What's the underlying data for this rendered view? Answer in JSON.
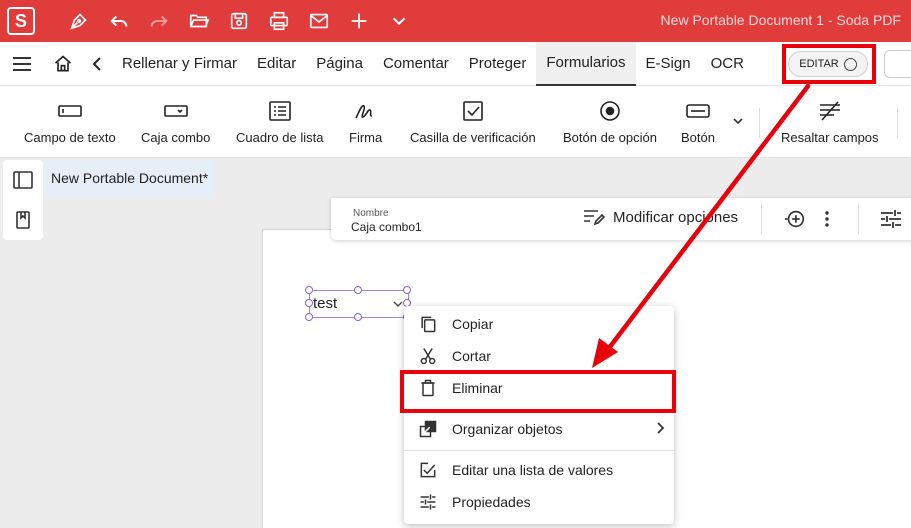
{
  "app": {
    "logo_letter": "S",
    "window_title": "New Portable Document 1  -  Soda PDF",
    "accent": "#e03c3c"
  },
  "quick_access": [
    "pen-icon",
    "undo-icon",
    "redo-icon",
    "open-folder-icon",
    "save-icon",
    "print-icon",
    "mail-icon",
    "add-icon",
    "dropdown-icon"
  ],
  "menu": {
    "items": [
      "Rellenar y Firmar",
      "Editar",
      "Página",
      "Comentar",
      "Proteger",
      "Formularios",
      "E-Sign",
      "OCR"
    ],
    "active": "Formularios",
    "edit_toggle": "EDITAR"
  },
  "ribbon": {
    "tools": [
      {
        "label": "Campo de texto",
        "icon": "text-field-icon"
      },
      {
        "label": "Caja combo",
        "icon": "combo-box-icon"
      },
      {
        "label": "Cuadro de lista",
        "icon": "list-box-icon"
      },
      {
        "label": "Firma",
        "icon": "signature-icon"
      },
      {
        "label": "Casilla de verificación",
        "icon": "checkbox-icon"
      },
      {
        "label": "Botón de opción",
        "icon": "radio-button-icon"
      },
      {
        "label": "Botón",
        "icon": "button-icon"
      },
      {
        "label": "Resaltar campos",
        "icon": "highlight-fields-icon"
      }
    ]
  },
  "document": {
    "tab_title": "New Portable Document*"
  },
  "properties_bar": {
    "name_label": "Nombre",
    "name_value": "Caja combo1",
    "modify_label": "Modificar opciones"
  },
  "combo_field": {
    "value": "test"
  },
  "context_menu": {
    "items": [
      {
        "label": "Copiar",
        "icon": "copy-icon"
      },
      {
        "label": "Cortar",
        "icon": "cut-icon"
      },
      {
        "label": "Eliminar",
        "icon": "delete-icon"
      },
      {
        "label": "Organizar objetos",
        "icon": "arrange-icon"
      },
      {
        "label": "Editar una lista de valores",
        "icon": "edit-list-icon"
      },
      {
        "label": "Propiedades",
        "icon": "properties-icon"
      }
    ]
  },
  "annotation_color": "#e8000b"
}
